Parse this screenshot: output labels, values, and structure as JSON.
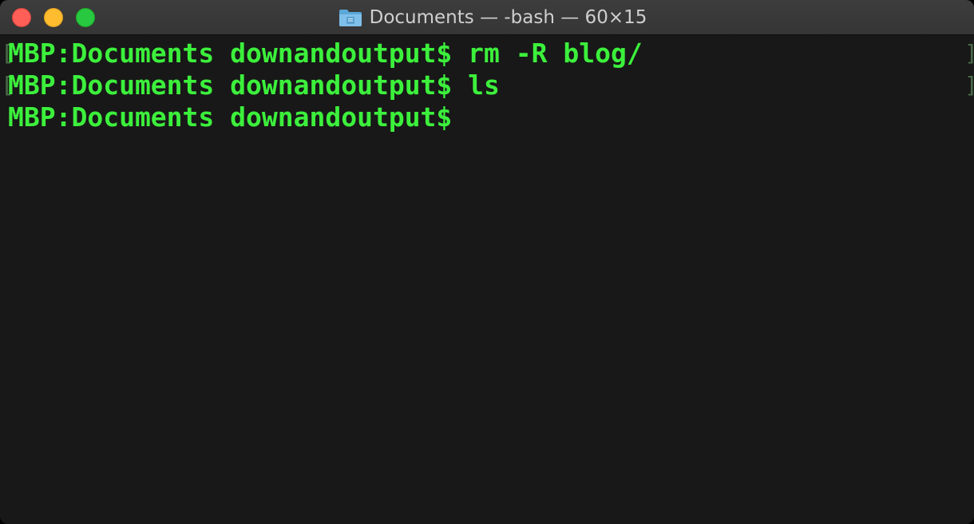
{
  "window": {
    "title": "Documents — -bash — 60×15",
    "folder_icon": "folder-icon",
    "colors": {
      "close": "#ff5f57",
      "minimize": "#febc2e",
      "zoom": "#28c840",
      "terminal_bg": "#181818",
      "text": "#3cf03c"
    }
  },
  "terminal": {
    "lines": [
      {
        "text": "MBP:Documents downandoutput$ rm -R blog/",
        "marked": true
      },
      {
        "text": "MBP:Documents downandoutput$ ls",
        "marked": true
      },
      {
        "text": "MBP:Documents downandoutput$",
        "marked": false
      }
    ],
    "mark_left": "[",
    "mark_right": "]"
  }
}
